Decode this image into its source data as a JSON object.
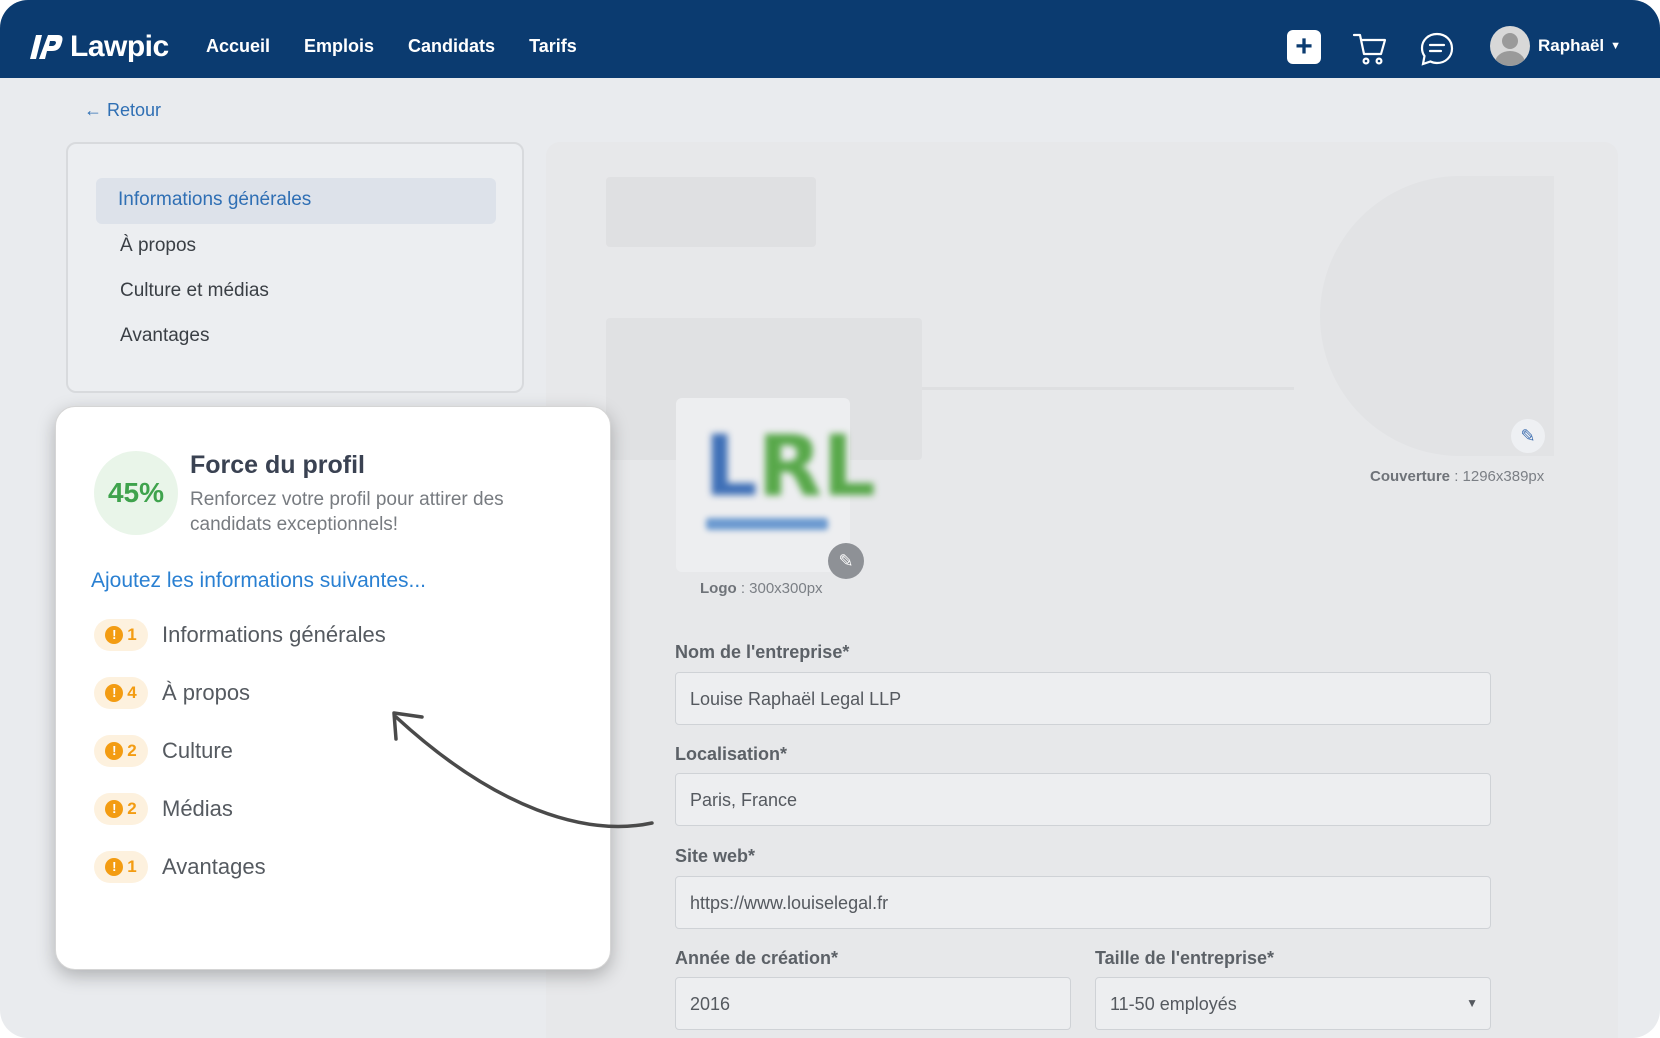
{
  "nav": {
    "brand": "Lawpic",
    "links": [
      "Accueil",
      "Emplois",
      "Candidats",
      "Tarifs"
    ],
    "add_icon": "plus-icon",
    "cart_icon": "cart-icon",
    "messages_icon": "chat-icon",
    "user_name": "Raphaël",
    "colors": {
      "bar": "#0b3b70"
    }
  },
  "back": {
    "label": "← Retour"
  },
  "sidebar": {
    "items": [
      {
        "label": "Informations générales",
        "active": true
      },
      {
        "label": "À propos"
      },
      {
        "label": "Culture et médias"
      },
      {
        "label": "Avantages"
      }
    ]
  },
  "profile_strength": {
    "percent": "45%",
    "title": "Force du profil",
    "subtitle": "Renforcez votre profil pour attirer des candidats exceptionnels!",
    "add_heading": "Ajoutez les informations suivantes...",
    "todos": [
      {
        "count": "1",
        "label": "Informations générales"
      },
      {
        "count": "4",
        "label": "À propos"
      },
      {
        "count": "2",
        "label": "Culture"
      },
      {
        "count": "2",
        "label": "Médias"
      },
      {
        "count": "1",
        "label": "Avantages"
      }
    ]
  },
  "images": {
    "logo_text": "LRL",
    "logo_caption_label": "Logo",
    "logo_caption_size": " : 300x300px",
    "cover_caption_label": "Couverture",
    "cover_caption_size": " : 1296x389px"
  },
  "form": {
    "company_label": "Nom de l'entreprise*",
    "company_value": "Louise Raphaël Legal LLP",
    "location_label": "Localisation*",
    "location_value": "Paris, France",
    "website_label": "Site web*",
    "website_value": "https://www.louiselegal.fr",
    "year_label": "Année de création*",
    "year_value": "2016",
    "size_label": "Taille de l'entreprise*",
    "size_value": "11-50 employés"
  }
}
